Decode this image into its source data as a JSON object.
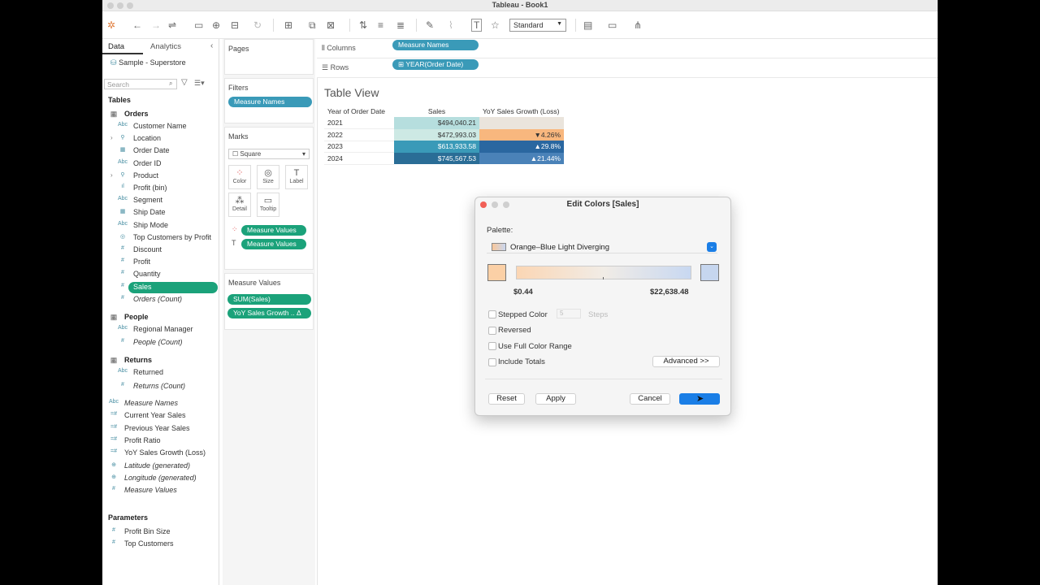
{
  "window": {
    "title": "Tableau - Book1"
  },
  "toolbar": {
    "view_size": "Standard"
  },
  "datapane": {
    "tabs": [
      "Data",
      "Analytics"
    ],
    "source": "Sample - Superstore",
    "search_placeholder": "Search",
    "tables_header": "Tables",
    "orders": {
      "name": "Orders",
      "fields": [
        {
          "label": "Customer Name",
          "type": "Abc"
        },
        {
          "label": "Location",
          "type": "geo"
        },
        {
          "label": "Order Date",
          "type": "date"
        },
        {
          "label": "Order ID",
          "type": "Abc"
        },
        {
          "label": "Product",
          "type": "geo"
        },
        {
          "label": "Profit (bin)",
          "type": "bin"
        },
        {
          "label": "Segment",
          "type": "Abc"
        },
        {
          "label": "Ship Date",
          "type": "date"
        },
        {
          "label": "Ship Mode",
          "type": "Abc"
        },
        {
          "label": "Top Customers by Profit",
          "type": "set"
        },
        {
          "label": "Discount",
          "type": "#"
        },
        {
          "label": "Profit",
          "type": "#"
        },
        {
          "label": "Quantity",
          "type": "#"
        },
        {
          "label": "Sales",
          "type": "#"
        },
        {
          "label": "Orders (Count)",
          "type": "#"
        }
      ]
    },
    "people": {
      "name": "People",
      "fields": [
        {
          "label": "Regional Manager",
          "type": "Abc"
        },
        {
          "label": "People (Count)",
          "type": "#"
        }
      ]
    },
    "returns": {
      "name": "Returns",
      "fields": [
        {
          "label": "Returned",
          "type": "Abc"
        },
        {
          "label": "Returns (Count)",
          "type": "#"
        }
      ]
    },
    "extra_fields": [
      {
        "label": "Measure Names",
        "type": "Abc"
      },
      {
        "label": "Current Year Sales",
        "type": "=#"
      },
      {
        "label": "Previous Year Sales",
        "type": "=#"
      },
      {
        "label": "Profit Ratio",
        "type": "=#"
      },
      {
        "label": "YoY Sales Growth (Loss)",
        "type": "=#"
      },
      {
        "label": "Latitude (generated)",
        "type": "globe"
      },
      {
        "label": "Longitude (generated)",
        "type": "globe"
      },
      {
        "label": "Measure Values",
        "type": "#"
      }
    ],
    "parameters_header": "Parameters",
    "parameters": [
      {
        "label": "Profit Bin Size",
        "type": "#"
      },
      {
        "label": "Top Customers",
        "type": "#"
      }
    ]
  },
  "shelves": {
    "pages": "Pages",
    "filters": "Filters",
    "filter_pill": "Measure Names",
    "marks": "Marks",
    "mark_type": "Square",
    "mark_buttons": [
      "Color",
      "Size",
      "Label",
      "Detail",
      "Tooltip"
    ],
    "mark_pills": [
      "Measure Values",
      "Measure Values"
    ],
    "measure_values_header": "Measure Values",
    "measure_pills": [
      "SUM(Sales)",
      "YoY Sales Growth .. Δ"
    ],
    "columns_label": "Columns",
    "columns_pill": "Measure Names",
    "rows_label": "Rows",
    "rows_pill": "⊞ YEAR(Order Date)"
  },
  "view": {
    "title": "Table View",
    "headers": [
      "Year of Order Date",
      "Sales",
      "YoY Sales Growth (Loss)"
    ],
    "rows": [
      {
        "year": "2021",
        "sales": "$494,040.21",
        "yoy": "",
        "sales_color": "#b6dede",
        "yoy_color": "#eae4dc",
        "sales_text": "#333333",
        "yoy_text": "#333333"
      },
      {
        "year": "2022",
        "sales": "$472,993.03",
        "yoy": "▼4.26%",
        "sales_color": "#cde9e4",
        "yoy_color": "#f8b77e",
        "sales_text": "#333333",
        "yoy_text": "#333333"
      },
      {
        "year": "2023",
        "sales": "$613,933.58",
        "yoy": "▲29.8%",
        "sales_color": "#3a9ab8",
        "yoy_color": "#2a67a0",
        "sales_text": "#ffffff",
        "yoy_text": "#ffffff"
      },
      {
        "year": "2024",
        "sales": "$745,567.53",
        "yoy": "▲21.44%",
        "sales_color": "#2a6d96",
        "yoy_color": "#4a82b8",
        "sales_text": "#ffffff",
        "yoy_text": "#ffffff"
      }
    ]
  },
  "dialog": {
    "title": "Edit Colors [Sales]",
    "palette_label": "Palette:",
    "palette_name": "Orange–Blue Light Diverging",
    "min_value": "$0.44",
    "max_value": "$22,638.48",
    "start_color": "#fbd0a6",
    "end_color": "#c6d6ef",
    "stepped_color": "Stepped Color",
    "steps_value": "5",
    "steps_label": "Steps",
    "reversed": "Reversed",
    "full_range": "Use Full Color Range",
    "include_totals": "Include Totals",
    "advanced": "Advanced >>",
    "reset": "Reset",
    "apply": "Apply",
    "cancel": "Cancel",
    "ok": ""
  }
}
